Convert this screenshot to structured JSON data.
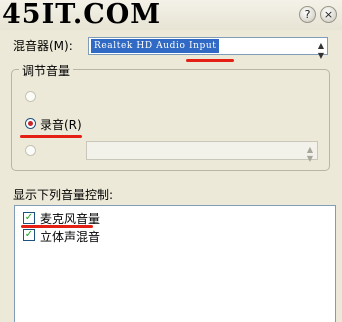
{
  "watermark": "45IT.COM",
  "window": {
    "help_glyph": "?",
    "close_glyph": "×"
  },
  "mixer": {
    "label": "混音器(M):",
    "selected": "Realtek HD Audio Input"
  },
  "volume_group": {
    "title": "调节音量",
    "record_label": "录音(R)"
  },
  "controls": {
    "label": "显示下列音量控制:",
    "items": [
      {
        "label": "麦克风音量",
        "checked": true
      },
      {
        "label": "立体声混音",
        "checked": true
      }
    ]
  },
  "colors": {
    "annotation_red": "#e41f13",
    "dialog_bg": "#ece9d8",
    "selection_blue": "#316ac5"
  }
}
